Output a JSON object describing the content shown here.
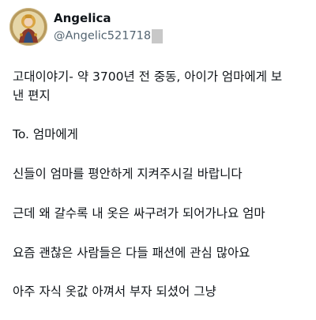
{
  "author": {
    "display_name": "Angelica",
    "handle": "@Angelic521718",
    "avatar_icon": "saint-icon-avatar"
  },
  "tweet": {
    "title_line1": "고대이야기- 약 3700년 전 중동, 아이가 엄마에게 보",
    "title_line2": "낸 편지",
    "to_line": "To. 엄마에게",
    "paragraphs": [
      "신들이 엄마를 평안하게 지켜주시길 바랍니다",
      "근데 왜 갈수록 내 옷은 싸구려가 되어가나요 엄마",
      "요즘 괜찮은 사람들은 다들 패션에 관심 많아요",
      "아주 자식 옷값 아껴서 부자 되셨어 그냥"
    ]
  },
  "colors": {
    "text": "#0f1419",
    "secondary": "#536471",
    "redaction": "#c8c8c8"
  }
}
